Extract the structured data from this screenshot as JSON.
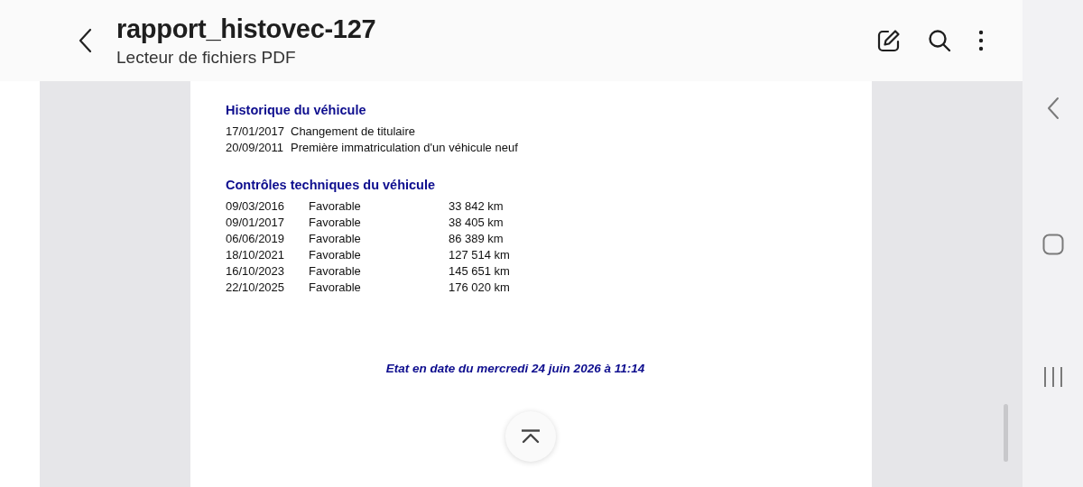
{
  "app_bar": {
    "title": "rapport_histovec-127",
    "subtitle": "Lecteur de fichiers PDF"
  },
  "history": {
    "heading": "Historique du véhicule",
    "rows": [
      {
        "date": "17/01/2017",
        "event": "Changement de titulaire"
      },
      {
        "date": "20/09/2011",
        "event": "Première immatriculation d'un véhicule neuf"
      }
    ]
  },
  "technical_inspections": {
    "heading": "Contrôles techniques du véhicule",
    "rows": [
      {
        "date": "09/03/2016",
        "result": "Favorable",
        "mileage": "33 842 km"
      },
      {
        "date": "09/01/2017",
        "result": "Favorable",
        "mileage": "38 405 km"
      },
      {
        "date": "06/06/2019",
        "result": "Favorable",
        "mileage": "86 389 km"
      },
      {
        "date": "18/10/2021",
        "result": "Favorable",
        "mileage": "127 514 km"
      },
      {
        "date": "16/10/2023",
        "result": "Favorable",
        "mileage": "145 651 km"
      },
      {
        "date": "22/10/2025",
        "result": "Favorable",
        "mileage": "176 020 km"
      }
    ]
  },
  "footer_note": "Etat en date du mercredi 24 juin 2026 à 11:14"
}
